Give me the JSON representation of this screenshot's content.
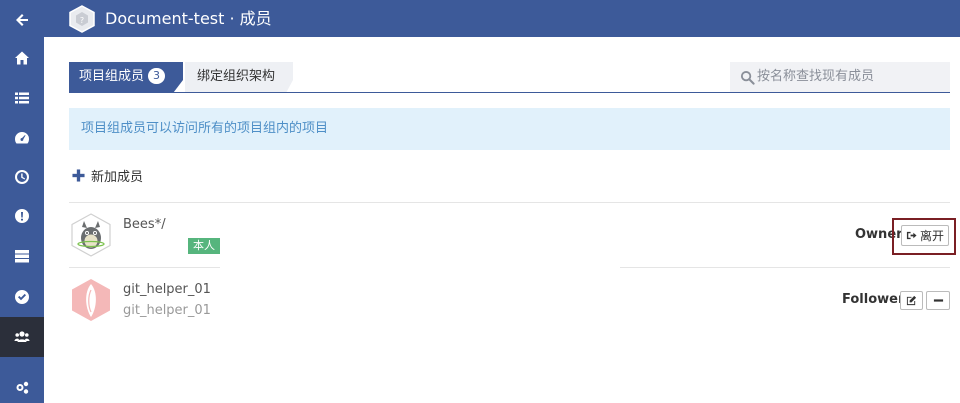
{
  "header": {
    "title": "Document-test · 成员"
  },
  "sidebar": {
    "items": [
      {
        "icon": "arrow-left-icon"
      },
      {
        "icon": "home-icon"
      },
      {
        "icon": "list-icon"
      },
      {
        "icon": "dashboard-icon"
      },
      {
        "icon": "clock-icon"
      },
      {
        "icon": "alert-icon"
      },
      {
        "icon": "server-icon"
      },
      {
        "icon": "check-circle-icon"
      },
      {
        "icon": "users-icon",
        "active": true
      },
      {
        "icon": "cogs-icon"
      }
    ]
  },
  "tabs": [
    {
      "label": "项目组成员",
      "badge": "3",
      "active": true
    },
    {
      "label": "绑定组织架构",
      "active": false
    }
  ],
  "search": {
    "placeholder": "按名称查找现有成员"
  },
  "info": {
    "text": "项目组成员可以访问所有的项目组内的项目"
  },
  "add_member": {
    "label": "新加成员"
  },
  "members": [
    {
      "name": "Bees*/",
      "tag": "本人",
      "role": "Owner",
      "leave_label": "离开"
    },
    {
      "name": "git_helper_01",
      "username": "git_helper_01",
      "role": "Follower"
    }
  ],
  "colors": {
    "brand": "#3d5a99",
    "sidebar_active": "#2b2f3a",
    "info_bg": "#e1f1fb",
    "info_text": "#4e8fc7",
    "self_tag": "#56b57d",
    "highlight": "#7a1f24"
  }
}
